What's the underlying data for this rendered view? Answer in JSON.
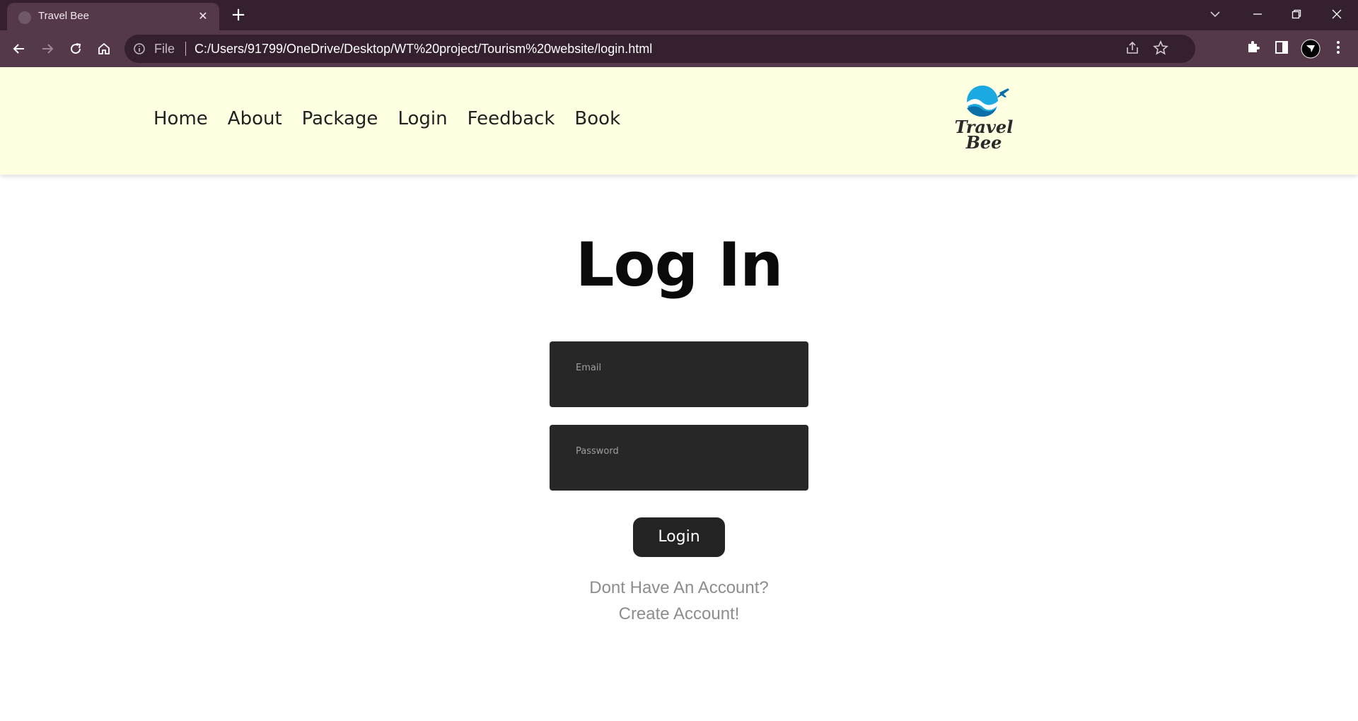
{
  "browser": {
    "tab_title": "Travel Bee",
    "omnibox_scheme": "File",
    "url": "C:/Users/91799/OneDrive/Desktop/WT%20project/Tourism%20website/login.html"
  },
  "nav": {
    "items": [
      "Home",
      "About",
      "Package",
      "Login",
      "Feedback",
      "Book"
    ]
  },
  "logo": {
    "line1": "Travel",
    "line2": "Bee"
  },
  "form": {
    "title": "Log In",
    "email_label": "Email",
    "password_label": "Password",
    "submit_label": "Login",
    "signup_prompt": "Dont Have An Account?",
    "signup_link": "Create Account!"
  },
  "colors": {
    "header_bg": "#ffffe2",
    "field_bg": "#272727",
    "button_bg": "#232323",
    "chrome_frame": "#35202f",
    "chrome_toolbar": "#55394b"
  }
}
